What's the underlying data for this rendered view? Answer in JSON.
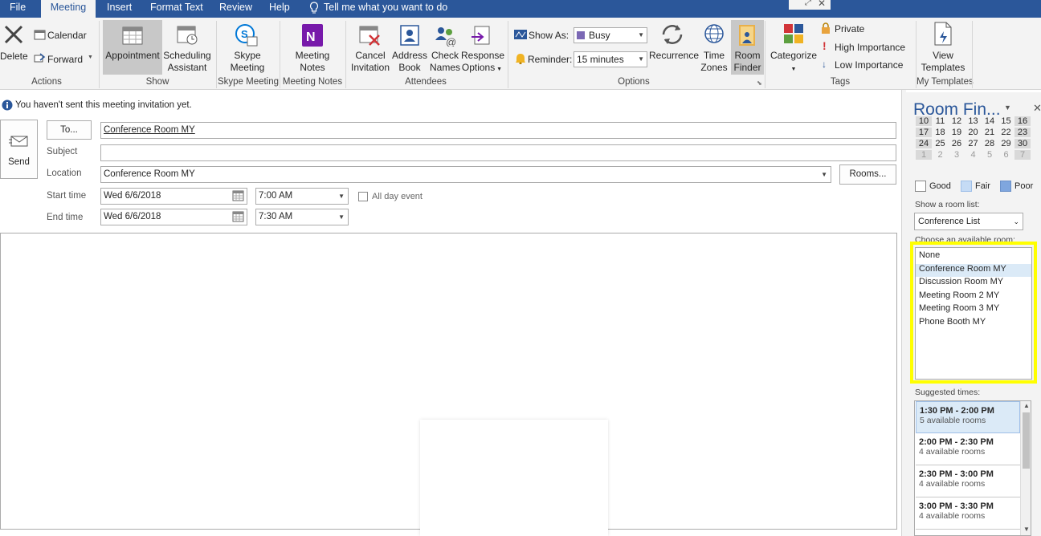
{
  "tabs": {
    "file": "File",
    "meeting": "Meeting",
    "insert": "Insert",
    "format_text": "Format Text",
    "review": "Review",
    "help": "Help",
    "tell_me": "Tell me what you want to do"
  },
  "ribbon": {
    "actions": {
      "delete": "Delete",
      "calendar": "Calendar",
      "forward": "Forward",
      "group": "Actions"
    },
    "show": {
      "appointment": "Appointment",
      "scheduling_1": "Scheduling",
      "scheduling_2": "Assistant",
      "group": "Show"
    },
    "skype": {
      "l1": "Skype",
      "l2": "Meeting",
      "group": "Skype Meeting"
    },
    "notes": {
      "l1": "Meeting",
      "l2": "Notes",
      "group": "Meeting Notes"
    },
    "attendees": {
      "cancel_1": "Cancel",
      "cancel_2": "Invitation",
      "address_1": "Address",
      "address_2": "Book",
      "check_1": "Check",
      "check_2": "Names",
      "response_1": "Response",
      "response_2": "Options",
      "group": "Attendees"
    },
    "options": {
      "show_as_label": "Show As:",
      "show_as_value": "Busy",
      "reminder_label": "Reminder:",
      "reminder_value": "15 minutes",
      "recurrence": "Recurrence",
      "time_1": "Time",
      "time_2": "Zones",
      "room_1": "Room",
      "room_2": "Finder",
      "group": "Options"
    },
    "tags": {
      "categorize": "Categorize",
      "private": "Private",
      "high": "High Importance",
      "low": "Low Importance",
      "group": "Tags"
    },
    "templates": {
      "l1": "View",
      "l2": "Templates",
      "group": "My Templates"
    }
  },
  "info_bar": "You haven't sent this meeting invitation yet.",
  "form": {
    "send": "Send",
    "to_button": "To...",
    "to_value": "Conference Room MY",
    "subject_label": "Subject",
    "subject_value": "",
    "location_label": "Location",
    "location_value": "Conference Room MY",
    "rooms_button": "Rooms...",
    "start_label": "Start time",
    "start_date": "Wed 6/6/2018",
    "start_time": "7:00 AM",
    "all_day": "All day event",
    "end_label": "End time",
    "end_date": "Wed 6/6/2018",
    "end_time": "7:30 AM"
  },
  "room_finder": {
    "title": "Room Fin...",
    "calendar_rows": [
      [
        "10",
        "11",
        "12",
        "13",
        "14",
        "15",
        "16"
      ],
      [
        "17",
        "18",
        "19",
        "20",
        "21",
        "22",
        "23"
      ],
      [
        "24",
        "25",
        "26",
        "27",
        "28",
        "29",
        "30"
      ],
      [
        "1",
        "2",
        "3",
        "4",
        "5",
        "6",
        "7"
      ]
    ],
    "legend": {
      "good": "Good",
      "fair": "Fair",
      "poor": "Poor"
    },
    "show_list_label": "Show a room list:",
    "room_list_value": "Conference List",
    "choose_label": "Choose an available room:",
    "rooms": [
      "None",
      "Conference Room MY",
      "Discussion Room MY",
      "Meeting Room 2 MY",
      "Meeting Room 3 MY",
      "Phone Booth MY"
    ],
    "suggested_label": "Suggested times:",
    "suggestions": [
      {
        "time": "1:30 PM - 2:00 PM",
        "rooms": "5 available rooms"
      },
      {
        "time": "2:00 PM - 2:30 PM",
        "rooms": "4 available rooms"
      },
      {
        "time": "2:30 PM - 3:00 PM",
        "rooms": "4 available rooms"
      },
      {
        "time": "3:00 PM - 3:30 PM",
        "rooms": "4 available rooms"
      }
    ]
  },
  "colors": {
    "accent": "#2b579a",
    "highlight": "#ffff00",
    "fair": "#c5dbf5",
    "poor": "#7fa6de",
    "selected_row": "#dbeaf7"
  }
}
